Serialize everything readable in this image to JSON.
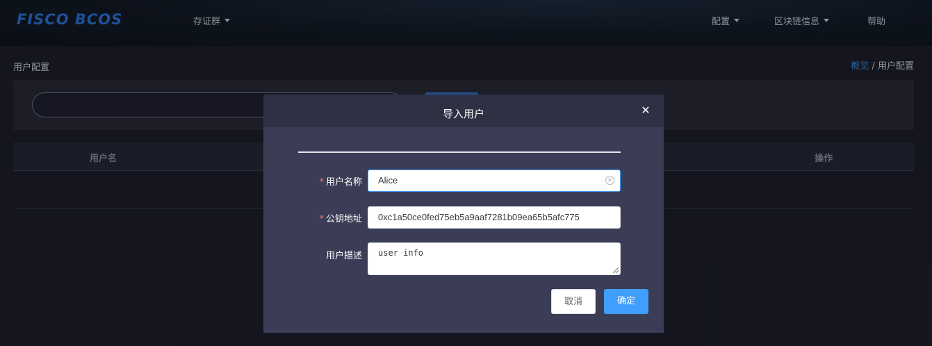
{
  "header": {
    "logo": "FISCO BCOS",
    "nav_left": [
      {
        "label": "存证群"
      }
    ],
    "nav_right": [
      {
        "label": "配置"
      },
      {
        "label": "区块链信息"
      },
      {
        "label": "帮助"
      }
    ]
  },
  "page": {
    "title": "用户配置",
    "breadcrumb": {
      "link": "概览",
      "separator": " / ",
      "current": "用户配置"
    }
  },
  "table": {
    "columns": [
      "用户名",
      "操作"
    ]
  },
  "dialog": {
    "title": "导入用户",
    "close_icon": "close-icon",
    "fields": {
      "username": {
        "label": "用户名称",
        "value": "Alice",
        "required": true
      },
      "address": {
        "label": "公钥地址",
        "value": "0xc1a50ce0fed75eb5a9aaf7281b09ea65b5afc775",
        "required": true
      },
      "description": {
        "label": "用户描述",
        "value": "user info",
        "required": false
      }
    },
    "cancel_label": "取消",
    "confirm_label": "确定"
  },
  "colors": {
    "accent": "#409eff",
    "brand": "#2c6fd4",
    "required": "#f56c6c"
  }
}
